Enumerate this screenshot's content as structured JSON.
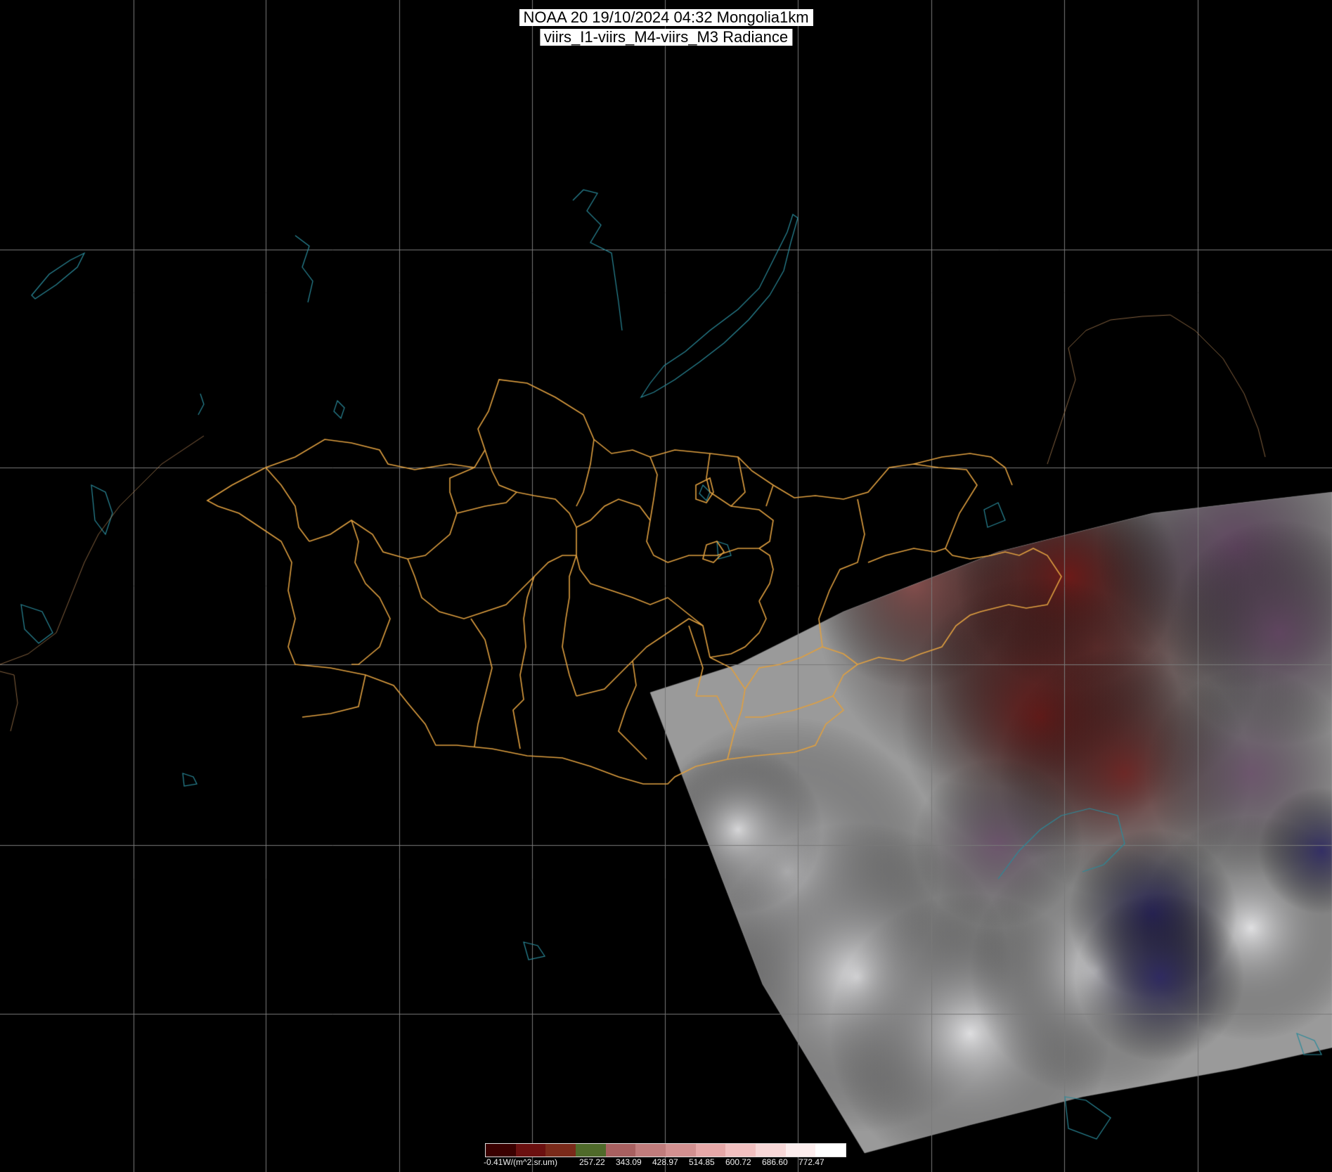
{
  "title": {
    "line1": "NOAA 20 19/10/2024 04:32 Mongolia1km",
    "line2": "viirs_I1-viirs_M4-viirs_M3 Radiance"
  },
  "colorbar": {
    "ticks": [
      "-0.41W/(m^2.sr.um)",
      "257.22",
      "343.09",
      "428.97",
      "514.85",
      "600.72",
      "686.60",
      "772.47"
    ],
    "colors": [
      "#3a0000",
      "#6b1010",
      "#7a2a1a",
      "#4f6a2a",
      "#a86060",
      "#c07c7c",
      "#d29090",
      "#e6a8a8",
      "#f2c0c0",
      "#f8d8d8",
      "#fdeeee",
      "#ffffff"
    ]
  },
  "map": {
    "background_color": "#000000",
    "graticule_color": "#7a7a7a",
    "boundary_color": "#e0a040",
    "water_color": "#2a8a9a",
    "swath_colors": {
      "dry_land": "#8a4a48",
      "vegetation": "#6e1614",
      "grey_plain": "#9a9a9a",
      "cloud": "#e8e8ea",
      "sea": "#2a2560",
      "purple_land": "#5a3a5a"
    }
  }
}
